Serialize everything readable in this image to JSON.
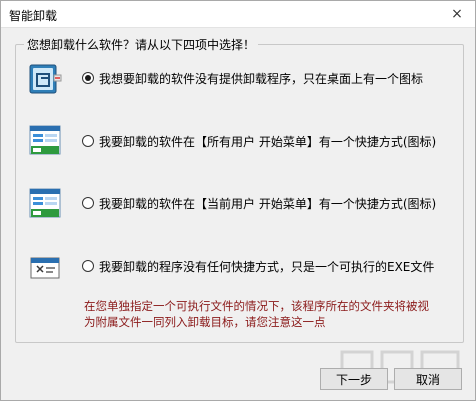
{
  "window": {
    "title": "智能卸载",
    "close_glyph": "×"
  },
  "question": "您想卸载什么软件？请从以下四项中选择！",
  "options": [
    {
      "label": "我想要卸载的软件没有提供卸载程序，只在桌面上有一个图标",
      "checked": true,
      "icon": "desktop-shortcut-icon"
    },
    {
      "label": "我要卸载的软件在【所有用户 开始菜单】有一个快捷方式(图标)",
      "checked": false,
      "icon": "all-users-start-menu-icon"
    },
    {
      "label": "我要卸载的软件在【当前用户 开始菜单】有一个快捷方式(图标)",
      "checked": false,
      "icon": "current-user-start-menu-icon"
    },
    {
      "label": "我要卸载的程序没有任何快捷方式，只是一个可执行的EXE文件",
      "checked": false,
      "icon": "exe-file-icon"
    }
  ],
  "note_lines": [
    "在您单独指定一个可执行文件的情况下，该程序所在的文件夹将被视",
    "为附属文件一同列入卸载目标，请您注意这一点"
  ],
  "buttons": {
    "next": "下一步",
    "cancel": "取消"
  },
  "colors": {
    "note_text": "#8b1a1a",
    "window_bg": "#f0f0f0"
  }
}
